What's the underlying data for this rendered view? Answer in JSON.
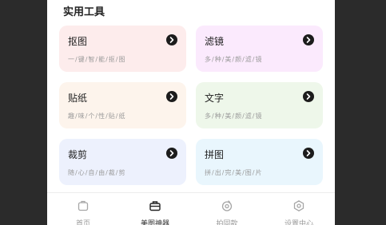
{
  "section": {
    "title": "实用工具"
  },
  "tools": [
    {
      "name": "抠图",
      "desc": "一/键/智/能/抠/图",
      "bg": "#fdecec"
    },
    {
      "name": "滤镜",
      "desc": "多/种/美/颜/滤/镜",
      "bg": "#fbeafd"
    },
    {
      "name": "贴纸",
      "desc": "趣/味/个/性/贴/纸",
      "bg": "#fdf4ec"
    },
    {
      "name": "文字",
      "desc": "多/种/美/颜/滤/镜",
      "bg": "#eef7ea"
    },
    {
      "name": "裁剪",
      "desc": "随/心/自/由/裁/剪",
      "bg": "#edf1fd"
    },
    {
      "name": "拼图",
      "desc": "拼/出/完/美/图/片",
      "bg": "#e9f6fd"
    }
  ],
  "tabbar": {
    "items": [
      {
        "label": "首页",
        "icon": "home-icon"
      },
      {
        "label": "美图神器",
        "icon": "toolbox-icon",
        "active": true
      },
      {
        "label": "拍同款",
        "icon": "camera-icon"
      },
      {
        "label": "设置中心",
        "icon": "settings-icon"
      }
    ]
  },
  "colors": {
    "accent": "#1c1c1c",
    "inactive": "#999999"
  }
}
